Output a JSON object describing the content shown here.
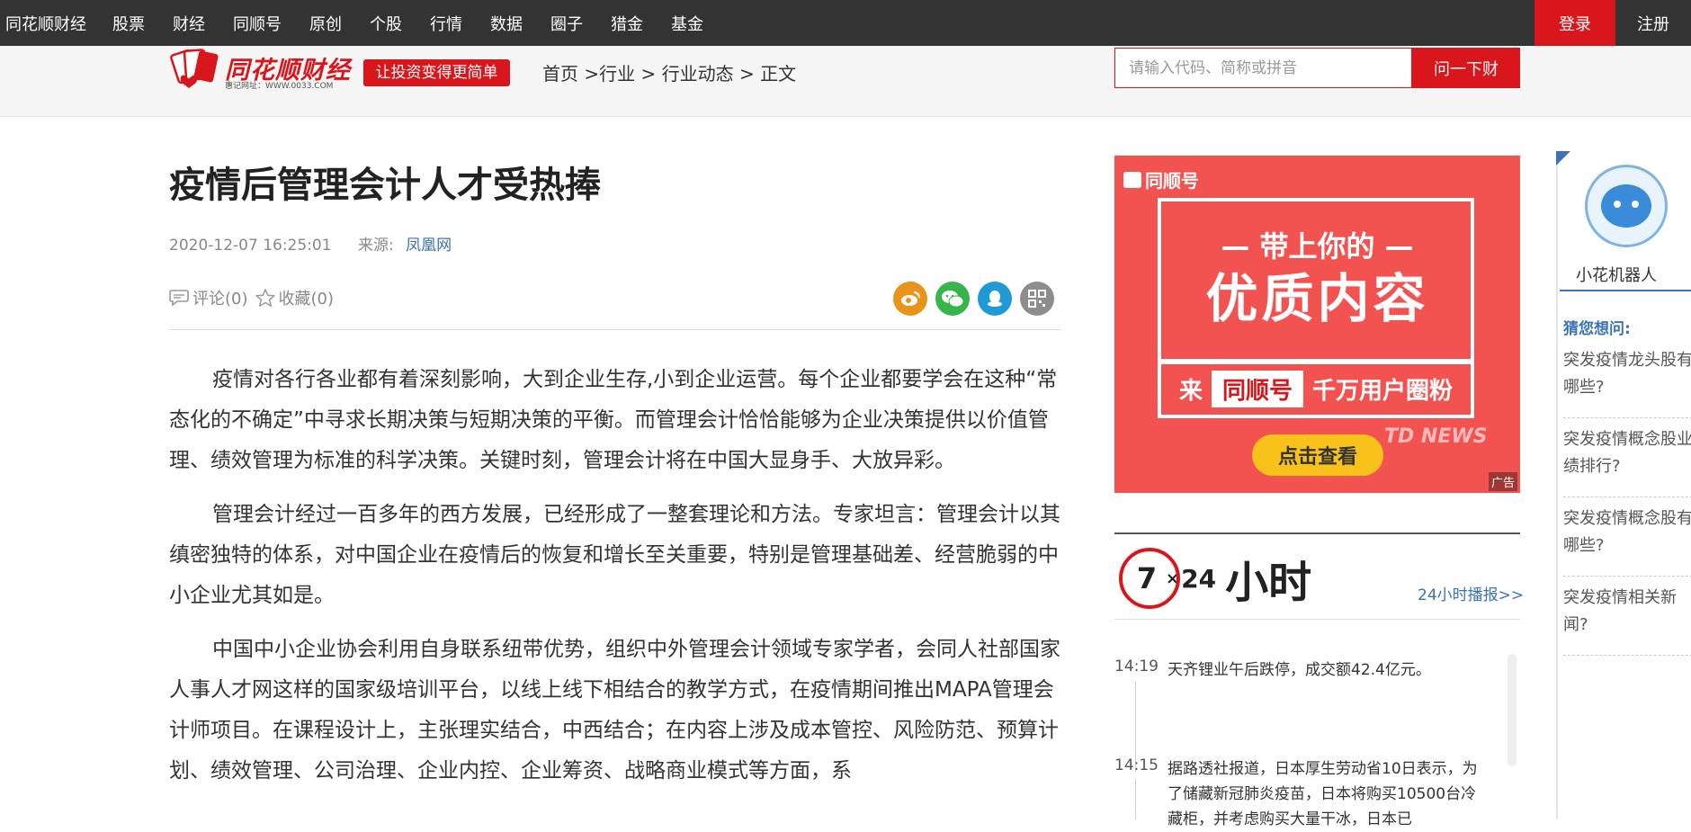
{
  "topnav": {
    "items": [
      "同花顺财经",
      "股票",
      "财经",
      "同顺号",
      "原创",
      "个股",
      "行情",
      "数据",
      "圈子",
      "猎金",
      "基金"
    ],
    "login": "登录",
    "register": "注册"
  },
  "header": {
    "logo_name": "同花顺财经",
    "logo_url": "惠记网址：WWW.0033.COM",
    "slogan": "让投资变得更简单",
    "breadcrumb": [
      "首页",
      "行业",
      "行业动态",
      "正文"
    ],
    "search_placeholder": "请输入代码、简称或拼音",
    "search_button": "问一下财"
  },
  "article": {
    "title": "疫情后管理会计人才受热捧",
    "datetime": "2020-12-07 16:25:01",
    "source_label": "来源:",
    "source": "凤凰网",
    "comment": "评论(0)",
    "favorite": "收藏(0)",
    "paragraphs": [
      "疫情对各行各业都有着深刻影响，大到企业生存,小到企业运营。每个企业都要学会在这种“常态化的不确定”中寻求长期决策与短期决策的平衡。而管理会计恰恰能够为企业决策提供以价值管理、绩效管理为标准的科学决策。关键时刻，管理会计将在中国大显身手、大放异彩。",
      "管理会计经过一百多年的西方发展，已经形成了一整套理论和方法。专家坦言：管理会计以其缜密独特的体系，对中国企业在疫情后的恢复和增长至关重要，特别是管理基础差、经营脆弱的中小企业尤其如是。",
      "中国中小企业协会利用自身联系纽带优势，组织中外管理会计领域专家学者，会同人社部国家人事人才网这样的国家级培训平台，以线上线下相结合的教学方式，在疫情期间推出MAPA管理会计师项目。在课程设计上，主张理实结合，中西结合；在内容上涉及成本管控、风险防范、预算计划、绩效管理、公司治理、企业内控、企业筹资、战略商业模式等方面，系"
    ]
  },
  "ad": {
    "brand": "同顺号",
    "line1": "— 带上你的 —",
    "line2": "优质内容",
    "row_prefix": "来",
    "row_highlight": "同顺号",
    "row_suffix": "千万用户圈粉",
    "watermark": "TD NEWS",
    "cta": "点击查看",
    "tag": "广告"
  },
  "live": {
    "logo_num": "7",
    "logo_x": "×",
    "logo_24": "24",
    "logo_hours": "小时",
    "more": "24小时播报>>",
    "news": [
      {
        "time": "14:19",
        "text": "天齐锂业午后跌停，成交额42.4亿元。"
      },
      {
        "time": "14:15",
        "text": "据路透社报道，日本厚生劳动省10日表示，为了储藏新冠肺炎疫苗，日本将购买10500台冷藏柜，并考虑购买大量干冰，日本已"
      }
    ]
  },
  "robot": {
    "name": "小花机器人",
    "guess_label": "猜您想问:",
    "questions": [
      [
        "突发疫情龙头股有",
        "哪些?"
      ],
      [
        "突发疫情概念股业",
        "绩排行?"
      ],
      [
        "突发疫情概念股有",
        "哪些?"
      ],
      [
        "突发疫情相关新",
        "闻?"
      ]
    ]
  },
  "colors": {
    "brand_red": "#d8161b",
    "link_blue": "#3b73b9",
    "nav_bg": "#333333",
    "ad_bg": "#f35350",
    "cta_yellow": "#f8c21b"
  }
}
